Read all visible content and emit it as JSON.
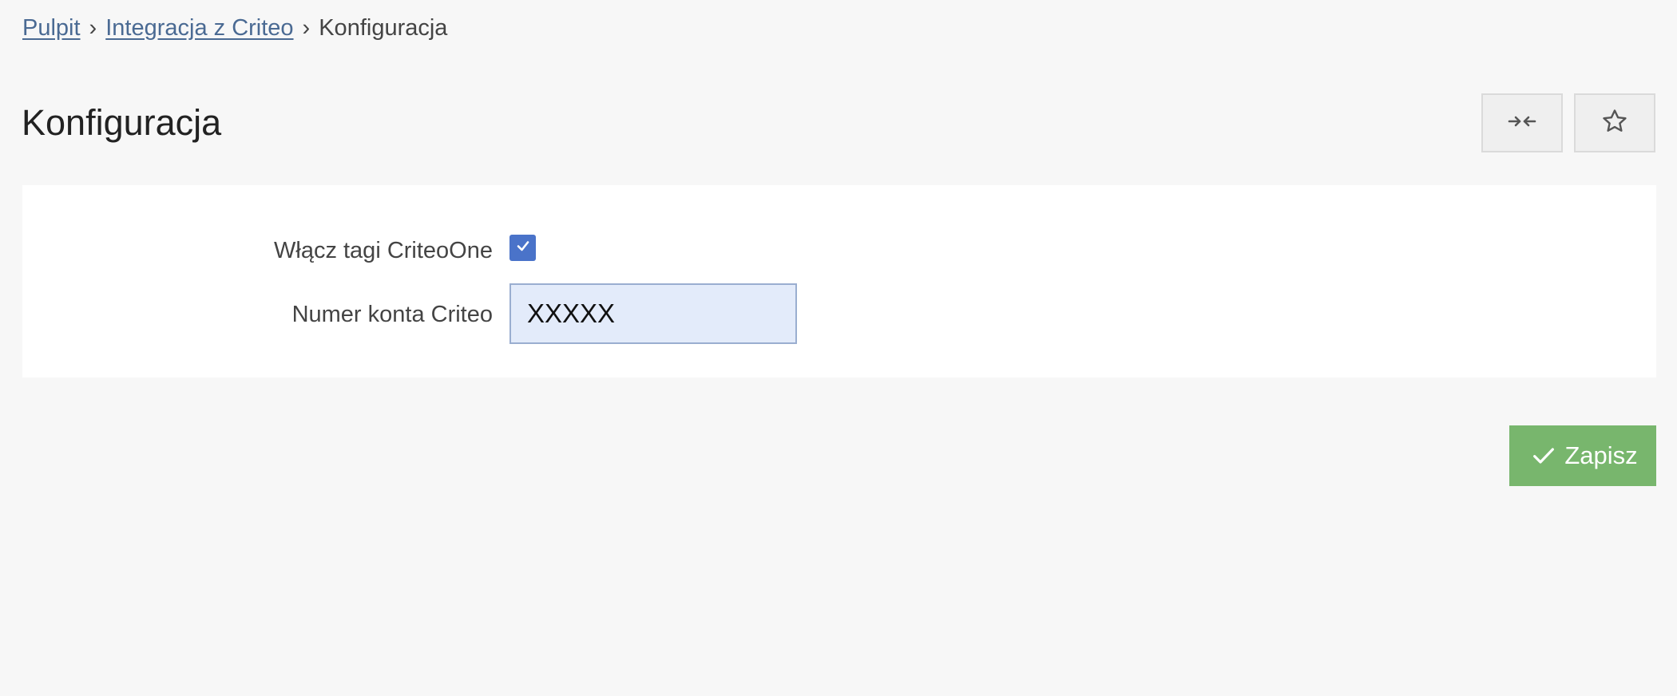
{
  "breadcrumb": {
    "items": [
      {
        "label": "Pulpit"
      },
      {
        "label": "Integracja z Criteo"
      },
      {
        "label": "Konfiguracja"
      }
    ],
    "separator": "›"
  },
  "page": {
    "title": "Konfiguracja"
  },
  "toolbar": {
    "collapse_icon": "collapse-arrows-icon",
    "favorite_icon": "star-icon"
  },
  "form": {
    "enable_tags_label": "Włącz tagi CriteoOne",
    "enable_tags_checked": true,
    "account_number_label": "Numer konta Criteo",
    "account_number_value": "XXXXX"
  },
  "actions": {
    "save_label": "Zapisz",
    "save_icon": "check-icon"
  },
  "colors": {
    "link": "#4a6a93",
    "checkbox": "#4a73c9",
    "input_bg": "#e3ebfa",
    "save_button": "#78b66d",
    "page_bg": "#f7f7f7"
  }
}
